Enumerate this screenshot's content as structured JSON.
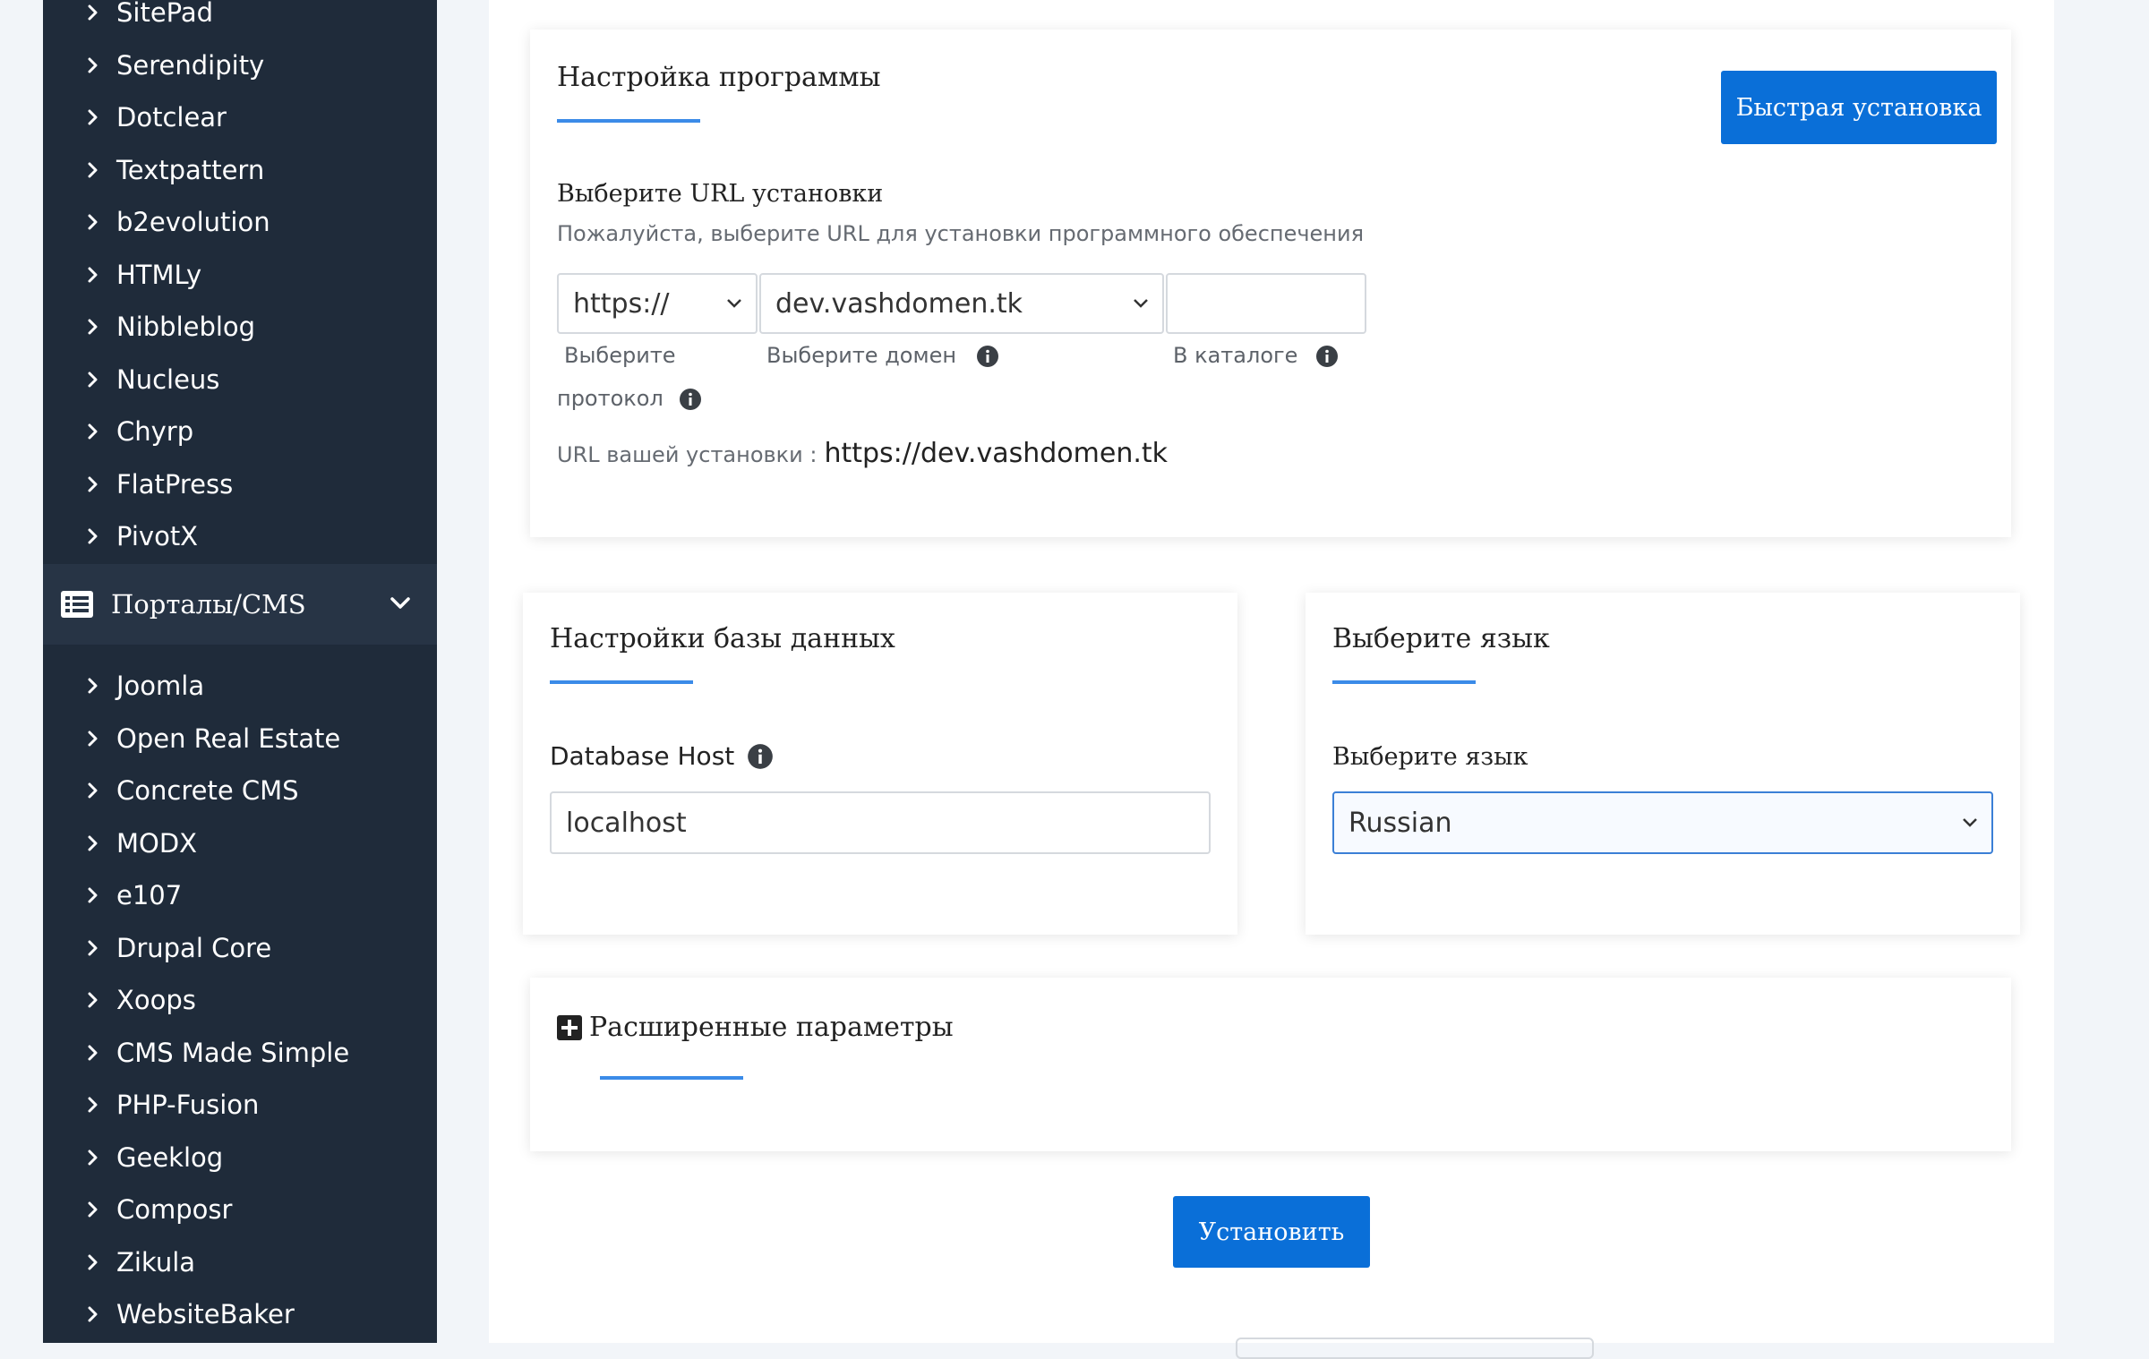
{
  "sidebar": {
    "items_top": [
      "SitePad",
      "Serendipity",
      "Dotclear",
      "Textpattern",
      "b2evolution",
      "HTMLy",
      "Nibbleblog",
      "Nucleus",
      "Chyrp",
      "FlatPress",
      "PivotX"
    ],
    "category": {
      "label": "Порталы/CMS",
      "icon": "list-icon"
    },
    "items_bottom": [
      "Joomla",
      "Open Real Estate",
      "Concrete CMS",
      "MODX",
      "e107",
      "Drupal Core",
      "Xoops",
      "CMS Made Simple",
      "PHP-Fusion",
      "Geeklog",
      "Composr",
      "Zikula",
      "WebsiteBaker"
    ]
  },
  "program_settings": {
    "title": "Настройка программы",
    "quick_install_label": "Быстрая установка",
    "url_heading": "Выберите URL установки",
    "url_hint": "Пожалуйста, выберите URL для установки программного обеспечения",
    "protocol_value": "https://",
    "protocol_label_1": "Выберите",
    "protocol_label_2": "протокол",
    "domain_value": "dev.vashdomen.tk",
    "domain_label": "Выберите домен",
    "directory_value": "",
    "directory_label": "В каталоге",
    "install_url_label": "URL вашей установки :",
    "install_url_value": "https://dev.vashdomen.tk"
  },
  "database": {
    "title": "Настройки базы данных",
    "host_label": "Database Host",
    "host_value": "localhost"
  },
  "language": {
    "title": "Выберите язык",
    "select_label": "Выберите язык",
    "selected": "Russian"
  },
  "advanced": {
    "title": "Расширенные параметры"
  },
  "install_button": "Установить",
  "colors": {
    "sidebar_bg": "#1f2b3a",
    "accent": "#0a6fd8",
    "underline": "#3b8be8"
  }
}
